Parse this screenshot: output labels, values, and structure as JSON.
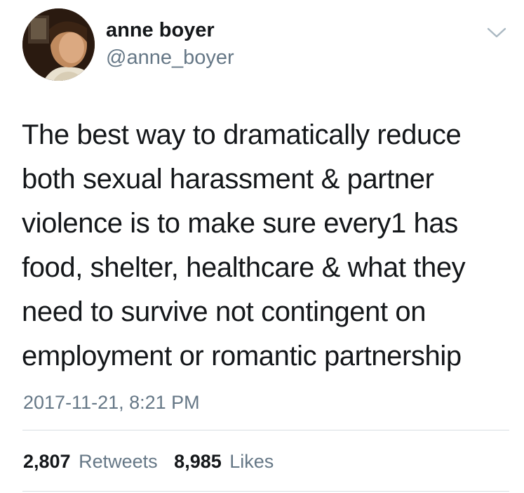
{
  "user": {
    "display_name": "anne boyer",
    "handle": "@anne_boyer"
  },
  "icons": {
    "avatar": "profile-photo",
    "menu": "chevron-down-icon"
  },
  "tweet": {
    "text_lines": [
      "The best way to dramatically reduce",
      "both sexual harassment & partner",
      "violence is to make sure every1 has",
      "food, shelter, healthcare & what they",
      "need to survive not contingent on",
      "employment or romantic partnership"
    ],
    "timestamp": "2017-11-21, 8:21 PM"
  },
  "stats": {
    "retweets_count": "2,807",
    "retweets_label": "Retweets",
    "likes_count": "8,985",
    "likes_label": "Likes"
  },
  "colors": {
    "text_primary": "#14171a",
    "text_secondary": "#657786",
    "divider": "#d9dee2"
  }
}
